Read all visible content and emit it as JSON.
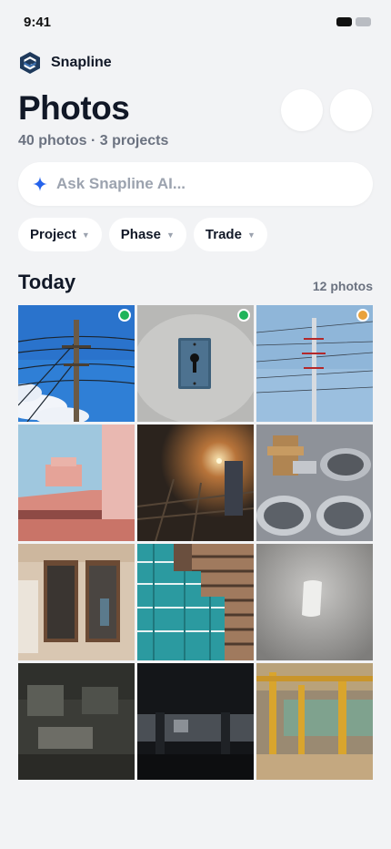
{
  "status": {
    "time": "9:41"
  },
  "brand": {
    "name": "Snapline"
  },
  "header": {
    "title": "Photos",
    "subtitle": "40 photos · 3 projects"
  },
  "search": {
    "placeholder": "Ask Snapline AI..."
  },
  "filters": [
    {
      "label": "Project"
    },
    {
      "label": "Phase"
    },
    {
      "label": "Trade"
    }
  ],
  "section": {
    "title": "Today",
    "count": "12 photos"
  },
  "colors": {
    "accent": "#2563eb",
    "status_green": "#1fb45a",
    "status_orange": "#e9a23b"
  },
  "photos": [
    {
      "subject": "utility-pole-blue-sky",
      "status": "green"
    },
    {
      "subject": "keyhole-plate",
      "status": "green"
    },
    {
      "subject": "power-line-tower",
      "status": "orange"
    },
    {
      "subject": "pink-building-corner",
      "status": ""
    },
    {
      "subject": "welder-sparks",
      "status": ""
    },
    {
      "subject": "metal-cans-valve",
      "status": ""
    },
    {
      "subject": "building-windows",
      "status": ""
    },
    {
      "subject": "teal-building-facade",
      "status": ""
    },
    {
      "subject": "white-object-fog",
      "status": ""
    },
    {
      "subject": "dark-workshop",
      "status": ""
    },
    {
      "subject": "dark-garage",
      "status": ""
    },
    {
      "subject": "yellow-steel-beams",
      "status": ""
    }
  ]
}
